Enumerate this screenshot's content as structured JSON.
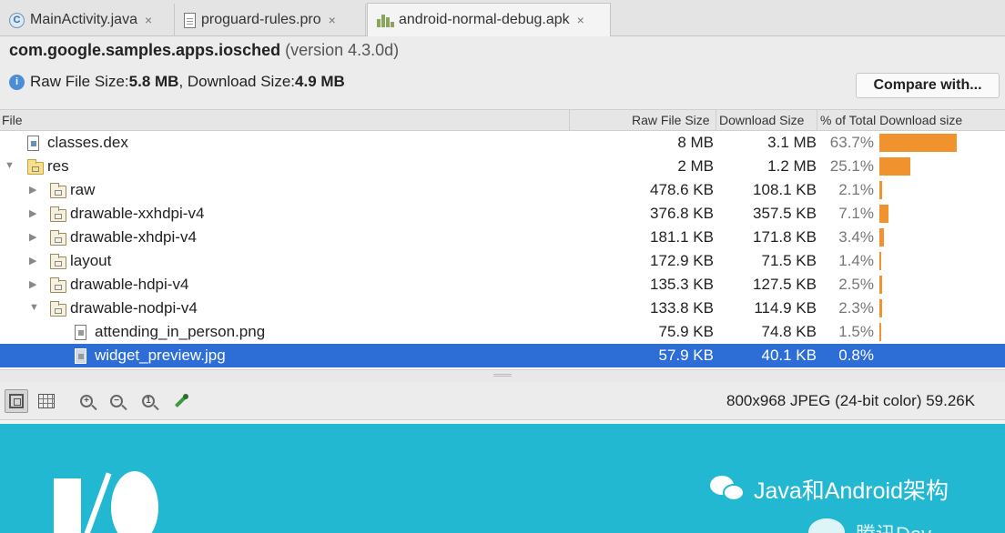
{
  "tabs": [
    {
      "label": "MainActivity.java",
      "icon": "java-class-icon",
      "close": "×"
    },
    {
      "label": "proguard-rules.pro",
      "icon": "text-file-icon",
      "close": "×"
    },
    {
      "label": "android-normal-debug.apk",
      "icon": "apk-icon",
      "close": "×"
    }
  ],
  "header": {
    "package": "com.google.samples.apps.iosched",
    "version": "(version 4.3.0d)",
    "raw_label": "Raw File Size: ",
    "raw_value": "5.8 MB",
    "download_label": ", Download Size: ",
    "download_value": "4.9 MB",
    "compare_button": "Compare with..."
  },
  "columns": {
    "file": "File",
    "raw": "Raw File Size",
    "download": "Download Size",
    "percent": "% of Total Download size"
  },
  "rows": [
    {
      "name": "classes.dex",
      "raw": "8 MB",
      "download": "3.1 MB",
      "percent": "63.7%",
      "fraction": 0.637,
      "type": "dex",
      "depth": 0,
      "expander": ""
    },
    {
      "name": "res",
      "raw": "2 MB",
      "download": "1.2 MB",
      "percent": "25.1%",
      "fraction": 0.251,
      "type": "res-folder",
      "depth": 0,
      "expander": "▼"
    },
    {
      "name": "raw",
      "raw": "478.6 KB",
      "download": "108.1 KB",
      "percent": "2.1%",
      "fraction": 0.021,
      "type": "folder",
      "depth": 1,
      "expander": "▶"
    },
    {
      "name": "drawable-xxhdpi-v4",
      "raw": "376.8 KB",
      "download": "357.5 KB",
      "percent": "7.1%",
      "fraction": 0.071,
      "type": "folder",
      "depth": 1,
      "expander": "▶"
    },
    {
      "name": "drawable-xhdpi-v4",
      "raw": "181.1 KB",
      "download": "171.8 KB",
      "percent": "3.4%",
      "fraction": 0.034,
      "type": "folder",
      "depth": 1,
      "expander": "▶"
    },
    {
      "name": "layout",
      "raw": "172.9 KB",
      "download": "71.5 KB",
      "percent": "1.4%",
      "fraction": 0.014,
      "type": "folder",
      "depth": 1,
      "expander": "▶"
    },
    {
      "name": "drawable-hdpi-v4",
      "raw": "135.3 KB",
      "download": "127.5 KB",
      "percent": "2.5%",
      "fraction": 0.025,
      "type": "folder",
      "depth": 1,
      "expander": "▶"
    },
    {
      "name": "drawable-nodpi-v4",
      "raw": "133.8 KB",
      "download": "114.9 KB",
      "percent": "2.3%",
      "fraction": 0.023,
      "type": "folder",
      "depth": 1,
      "expander": "▼"
    },
    {
      "name": "attending_in_person.png",
      "raw": "75.9 KB",
      "download": "74.8 KB",
      "percent": "1.5%",
      "fraction": 0.015,
      "type": "file",
      "depth": 2,
      "expander": ""
    },
    {
      "name": "widget_preview.jpg",
      "raw": "57.9 KB",
      "download": "40.1 KB",
      "percent": "0.8%",
      "fraction": 0.008,
      "type": "file",
      "depth": 2,
      "expander": "",
      "selected": true
    }
  ],
  "preview_toolbar": {
    "image_info": "800x968 JPEG (24-bit color) 59.26K",
    "tools": [
      "fit-icon",
      "grid-icon",
      "zoom-in-icon",
      "zoom-out-icon",
      "actual-size-icon",
      "color-picker-icon"
    ]
  },
  "watermark": {
    "text": "Java和Android架构",
    "partial_text": "腾讯Dev..."
  },
  "colors": {
    "selection": "#2d6ed6",
    "bar": "#f0922e",
    "preview_bg": "#23b8d1"
  }
}
